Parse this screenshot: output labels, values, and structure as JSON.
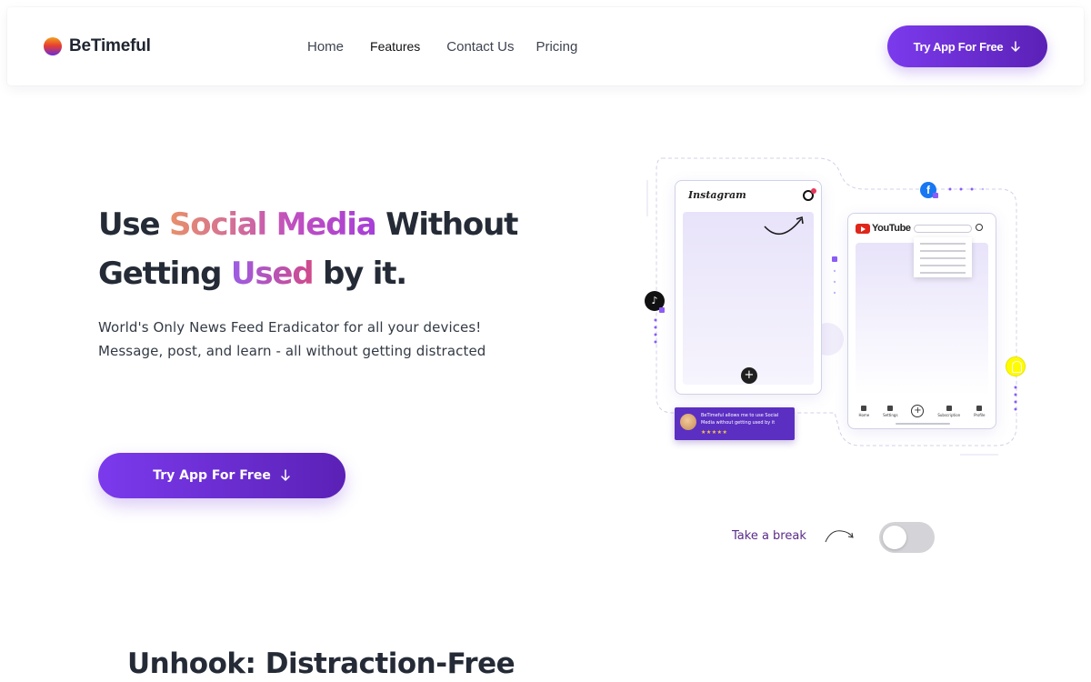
{
  "brand": {
    "name": "BeTimeful"
  },
  "nav": {
    "links": [
      "Home",
      "Features",
      "Contact Us",
      "Pricing"
    ],
    "cta_label": "Try App For Free"
  },
  "hero": {
    "title_1": "Use ",
    "title_highlight_1": "Social Media",
    "title_2": " Without Getting ",
    "title_highlight_2": "Used",
    "title_3": " by it.",
    "subtitle_line_1": "World's Only News Feed Eradicator for all your devices!",
    "subtitle_line_2": "Message, post, and learn - all without getting distracted",
    "cta_label": "Try App For Free"
  },
  "illustration": {
    "instagram_label": "Instagram",
    "youtube_label": "YouTube",
    "youtube_tabs": [
      "Home",
      "Settings",
      "",
      "Subscription",
      "Profile"
    ],
    "review_text": "BeTimeful allows me to use Social Media without getting used by it",
    "review_stars": "★★★★★"
  },
  "toggle": {
    "label": "Take a break",
    "state": "off"
  },
  "next_section": {
    "title": "Unhook: Distraction-Free"
  },
  "colors": {
    "accent": "#7b3aed",
    "accent_dark": "#5b21b6",
    "text": "#252b36"
  }
}
